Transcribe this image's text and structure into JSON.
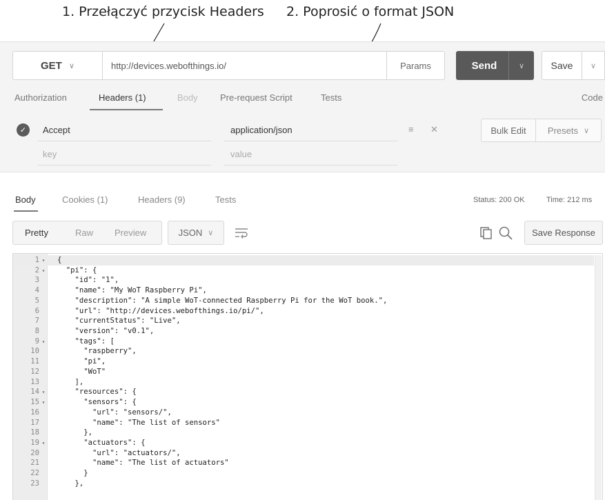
{
  "annotations": {
    "first": "1. Przełączyć przycisk Headers",
    "second": "2. Poprosić o format JSON"
  },
  "request": {
    "method": "GET",
    "url": "http://devices.webofthings.io/",
    "params_label": "Params",
    "send_label": "Send",
    "save_label": "Save"
  },
  "request_tabs": {
    "authorization": "Authorization",
    "headers": "Headers (1)",
    "body": "Body",
    "prerequest": "Pre-request Script",
    "tests": "Tests",
    "code": "Code"
  },
  "headers_table": {
    "rows": [
      {
        "key": "Accept",
        "value": "application/json"
      }
    ],
    "key_placeholder": "key",
    "value_placeholder": "value",
    "bulk_edit_label": "Bulk Edit",
    "presets_label": "Presets"
  },
  "response_tabs": {
    "body": "Body",
    "cookies": "Cookies (1)",
    "headers": "Headers (9)",
    "tests": "Tests",
    "status": "Status: 200 OK",
    "time": "Time: 212 ms"
  },
  "response_toolbar": {
    "pretty": "Pretty",
    "raw": "Raw",
    "preview": "Preview",
    "format": "JSON",
    "save_response": "Save Response"
  },
  "icons": {
    "method_dropdown": "chevron-down-icon",
    "send_dropdown": "chevron-down-icon",
    "save_dropdown": "chevron-down-icon",
    "header_enabled": "check-circle-icon",
    "bulk_menu": "hamburger-icon",
    "remove_header": "close-icon",
    "wrap": "wrap-lines-icon",
    "copy": "copy-icon",
    "search": "search-icon"
  },
  "colors": {
    "send_button": "#595959",
    "request_area": "#f4f4f4"
  },
  "code": [
    {
      "n": "1",
      "fold": true,
      "text": "{"
    },
    {
      "n": "2",
      "fold": true,
      "text": "  \"pi\": {"
    },
    {
      "n": "3",
      "fold": false,
      "text": "    \"id\": \"1\","
    },
    {
      "n": "4",
      "fold": false,
      "text": "    \"name\": \"My WoT Raspberry Pi\","
    },
    {
      "n": "5",
      "fold": false,
      "text": "    \"description\": \"A simple WoT-connected Raspberry Pi for the WoT book.\","
    },
    {
      "n": "6",
      "fold": false,
      "text": "    \"url\": \"http://devices.webofthings.io/pi/\","
    },
    {
      "n": "7",
      "fold": false,
      "text": "    \"currentStatus\": \"Live\","
    },
    {
      "n": "8",
      "fold": false,
      "text": "    \"version\": \"v0.1\","
    },
    {
      "n": "9",
      "fold": true,
      "text": "    \"tags\": ["
    },
    {
      "n": "10",
      "fold": false,
      "text": "      \"raspberry\","
    },
    {
      "n": "11",
      "fold": false,
      "text": "      \"pi\","
    },
    {
      "n": "12",
      "fold": false,
      "text": "      \"WoT\""
    },
    {
      "n": "13",
      "fold": false,
      "text": "    ],"
    },
    {
      "n": "14",
      "fold": true,
      "text": "    \"resources\": {"
    },
    {
      "n": "15",
      "fold": true,
      "text": "      \"sensors\": {"
    },
    {
      "n": "16",
      "fold": false,
      "text": "        \"url\": \"sensors/\","
    },
    {
      "n": "17",
      "fold": false,
      "text": "        \"name\": \"The list of sensors\""
    },
    {
      "n": "18",
      "fold": false,
      "text": "      },"
    },
    {
      "n": "19",
      "fold": true,
      "text": "      \"actuators\": {"
    },
    {
      "n": "20",
      "fold": false,
      "text": "        \"url\": \"actuators/\","
    },
    {
      "n": "21",
      "fold": false,
      "text": "        \"name\": \"The list of actuators\""
    },
    {
      "n": "22",
      "fold": false,
      "text": "      }"
    },
    {
      "n": "23",
      "fold": false,
      "text": "    },"
    }
  ]
}
